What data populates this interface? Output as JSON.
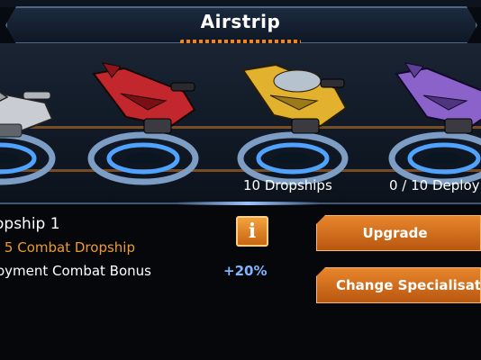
{
  "screen": {
    "title": "Airstrip"
  },
  "bays": [
    {
      "label": "",
      "ship_color": "#c9ccd2"
    },
    {
      "label": "",
      "ship_color": "#c1272d"
    },
    {
      "label": "10 Dropships",
      "ship_color": "#e2b12e"
    },
    {
      "label": "0 / 10 Deploy",
      "ship_color": "#8a62c9"
    }
  ],
  "selected": {
    "name": "opship 1",
    "class_label": "l 5 Combat Dropship",
    "bonus_label": "oyment Combat Bonus",
    "bonus_value": "+20%",
    "info_icon": "i"
  },
  "buttons": {
    "upgrade": "Upgrade",
    "change_specialisation": "Change Specialisatio"
  },
  "colors": {
    "accent_orange": "#e8862c",
    "bonus_blue": "#7fb4ff",
    "pad_glow": "#4fa3ff"
  }
}
